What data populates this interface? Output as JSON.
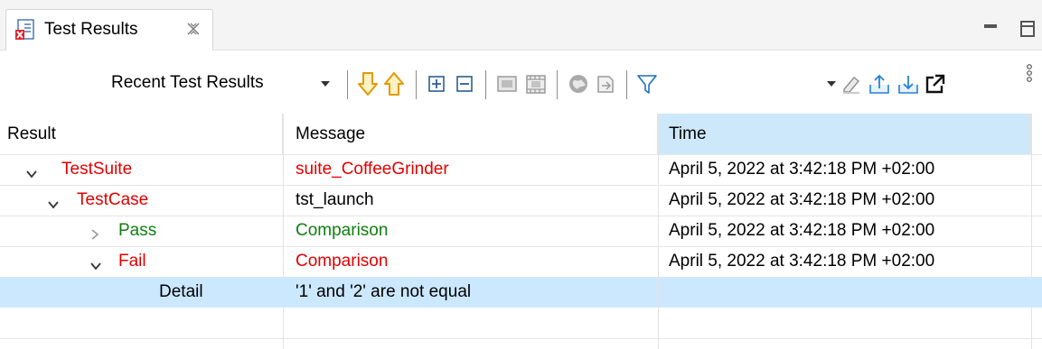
{
  "view": {
    "tab_title": "Test Results",
    "icons": {
      "tab": "test-results-icon",
      "close": "close-icon",
      "minimize": "minimize-icon",
      "maximize": "maximize-icon"
    }
  },
  "toolbar": {
    "recent_label": "Recent Test Results",
    "icons": [
      "previous-failure-icon",
      "next-failure-icon",
      "expand-all-icon",
      "collapse-all-icon",
      "show-screenshot-icon",
      "show-video-icon",
      "globe-icon",
      "export-icon",
      "filter-icon",
      "clear-icon",
      "import-icon",
      "export-results-icon",
      "open-external-icon",
      "view-menu-icon"
    ]
  },
  "columns": [
    "Result",
    "Message",
    "Time"
  ],
  "rows": [
    {
      "result": "TestSuite",
      "message": "suite_CoffeeGrinder",
      "time": "April 5, 2022 at 3:42:18 PM +02:00",
      "status": "fail",
      "expanded": true
    },
    {
      "result": "TestCase",
      "message": "tst_launch",
      "time": "April 5, 2022 at 3:42:18 PM +02:00",
      "status": "fail",
      "expanded": true
    },
    {
      "result": "Pass",
      "message": "Comparison",
      "time": "April 5, 2022 at 3:42:18 PM +02:00",
      "status": "pass",
      "expanded": false
    },
    {
      "result": "Fail",
      "message": "Comparison",
      "time": "April 5, 2022 at 3:42:18 PM +02:00",
      "status": "fail",
      "expanded": true
    },
    {
      "result": "Detail",
      "message": "'1' and '2' are not equal",
      "time": "",
      "status": "detail",
      "selected": true
    }
  ],
  "colors": {
    "fail": "#e10000",
    "pass": "#0e7f0e",
    "selection": "#cce8ff",
    "sorted_header": "#cde8fb"
  }
}
